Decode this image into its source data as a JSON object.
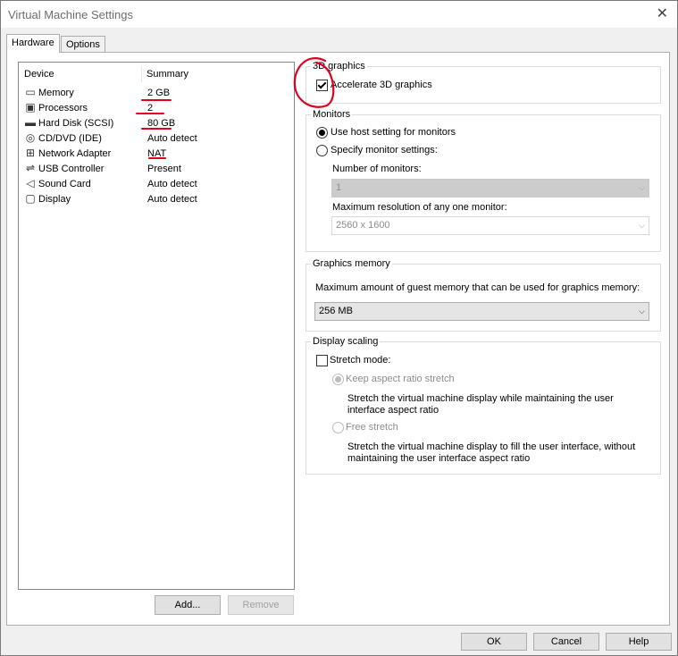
{
  "window": {
    "title": "Virtual Machine Settings",
    "close_glyph": "✕"
  },
  "tabs": [
    {
      "label": "Hardware",
      "active": true
    },
    {
      "label": "Options",
      "active": false
    }
  ],
  "device_list": {
    "headers": {
      "device": "Device",
      "summary": "Summary"
    },
    "rows": [
      {
        "icon": "memory-icon",
        "glyph": "▭",
        "device": "Memory",
        "summary": "2 GB"
      },
      {
        "icon": "processor-icon",
        "glyph": "▣",
        "device": "Processors",
        "summary": "2"
      },
      {
        "icon": "hard-disk-icon",
        "glyph": "▬",
        "device": "Hard Disk (SCSI)",
        "summary": "80 GB"
      },
      {
        "icon": "cd-dvd-icon",
        "glyph": "◎",
        "device": "CD/DVD (IDE)",
        "summary": "Auto detect"
      },
      {
        "icon": "network-adapter-icon",
        "glyph": "⊞",
        "device": "Network Adapter",
        "summary": "NAT"
      },
      {
        "icon": "usb-icon",
        "glyph": "⇌",
        "device": "USB Controller",
        "summary": "Present"
      },
      {
        "icon": "speaker-icon",
        "glyph": "◁",
        "device": "Sound Card",
        "summary": "Auto detect"
      },
      {
        "icon": "monitor-icon",
        "glyph": "▢",
        "device": "Display",
        "summary": "Auto detect"
      }
    ]
  },
  "list_buttons": {
    "add": "Add...",
    "remove": "Remove"
  },
  "graphics_3d": {
    "group_label": "3D graphics",
    "accelerate_label": "Accelerate 3D graphics",
    "accelerate_checked": true
  },
  "monitors": {
    "group_label": "Monitors",
    "use_host_label": "Use host setting for monitors",
    "specify_label": "Specify monitor settings:",
    "selected": "use_host",
    "number_label": "Number of monitors:",
    "number_value": "1",
    "max_res_label": "Maximum resolution of any one monitor:",
    "max_res_value": "2560 x 1600"
  },
  "graphics_memory": {
    "group_label": "Graphics memory",
    "description": "Maximum amount of guest memory that can be used for graphics memory:",
    "value": "256 MB"
  },
  "display_scaling": {
    "group_label": "Display scaling",
    "stretch_label": "Stretch mode:",
    "stretch_checked": false,
    "keep_aspect_label": "Keep aspect ratio stretch",
    "keep_aspect_desc": "Stretch the virtual machine display while maintaining the user interface aspect ratio",
    "free_stretch_label": "Free stretch",
    "free_stretch_desc": "Stretch the virtual machine display to fill the user interface, without maintaining the user interface aspect ratio"
  },
  "footer": {
    "ok": "OK",
    "cancel": "Cancel",
    "help": "Help"
  },
  "annotation_color": "#e0001b"
}
